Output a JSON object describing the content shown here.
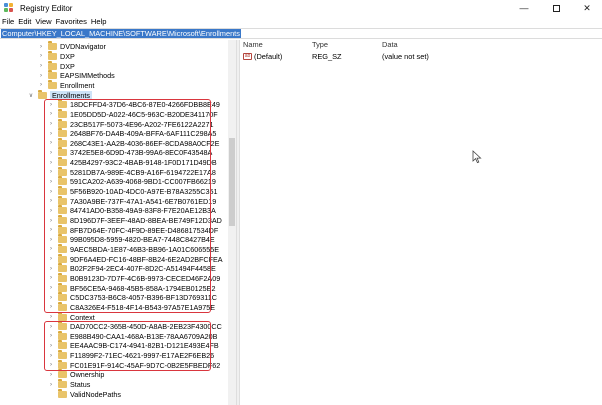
{
  "window": {
    "title": "Registry Editor",
    "controls": {
      "minimize": "—",
      "close": "✕"
    }
  },
  "menu": [
    "File",
    "Edit",
    "View",
    "Favorites",
    "Help"
  ],
  "address": "Computer\\HKEY_LOCAL_MACHINE\\SOFTWARE\\Microsoft\\Enrollments",
  "tree": {
    "above": [
      "DVDNavigator",
      "DXP",
      "DXP",
      "EAPSIMMethods",
      "Enrollment"
    ],
    "enrollments_label": "Enrollments",
    "group1": [
      "18DCFFD4-37D6-4BC6-87E0-4266FDBB8E49",
      "1E05DD5D-A022-46C5-963C-B20DE341170F",
      "23CB517F-5073-4E96-A202-7FE6122A2271",
      "2648BF76-DA4B-409A-BFFA-6AF111C298A5",
      "268C43E1-AA2B-4036-86EF-8CDA98A0CF2E",
      "3742E5E8-6D9D-473B-99A6-8EC0F43548A",
      "425B4297-93C2-4BAB-9148-1F0D171D49DB",
      "5281DB7A-989E-4CB9-A16F-6194722E17A8",
      "591CA202-A639-4068-9BD1-CC007FB66219",
      "5F56B920-10AD-4DC0-A97E-B78A3255C351",
      "7A30A9BE-737F-47A1-A541-6E7B0761ED19",
      "84741AD0-B358-49A9-83F8-F7E20AE12B3A",
      "8D196D7F-3EEF-48AD-8BEA-BE749F12D3AD",
      "8FB7D64E-70FC-4F9D-89EE-D486817534DF",
      "99B095D8-5959-4820-BEA7-7448C8427B4E",
      "9AEC5BDA-1E87-46B3-BB96-1A01C606555E",
      "9DF6A4ED-FC16-48BF-8B24-6E2AD2BFCFEA",
      "B02F2F94-2EC4-407F-8D2C-A51494F4458E",
      "B0B9123D-7D7F-4C6B-9973-CECED46F2A09",
      "BF56CE5A-9468-45B5-858A-1794EB0125E2",
      "C5DC3753-B6C8-4057-B396-BF13D769311C",
      "C8A326E4-F518-4F14-B543-97A57E1A975E"
    ],
    "context_label": "Context",
    "group2": [
      "DAD70CC2-365B-450D-A8AB-2EB23F4300CC",
      "E988B490-CAA1-468A-B13E-78AA6709A20B",
      "EE4AAC9B-C174-4941-82B1-D121E493E4FB",
      "F11899F2-71EC-4621-9997-E17AE2F6EB26",
      "FC01E91F-914C-45AF-9D7C-0B2E5FBEDF62"
    ],
    "below": [
      "Ownership",
      "Status",
      "ValidNodePaths"
    ]
  },
  "list": {
    "headers": {
      "name": "Name",
      "type": "Type",
      "data": "Data"
    },
    "rows": [
      {
        "icon": "ab",
        "name": "(Default)",
        "type": "REG_SZ",
        "data": "(value not set)"
      }
    ]
  },
  "colors": {
    "address_highlight": "#3a78c9",
    "folder": "#e9c46a",
    "highlight_box": "#d9363e"
  }
}
